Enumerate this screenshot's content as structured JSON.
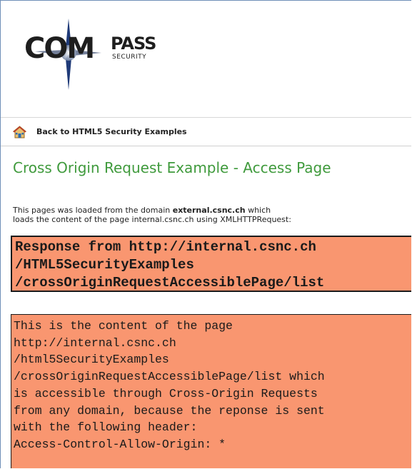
{
  "logo": {
    "word": "COM",
    "pass": "PASS",
    "security": "SECURITY",
    "icon": "compass-logo-icon"
  },
  "nav": {
    "home_icon": "home-icon",
    "back_link": "Back to HTML5 Security Examples"
  },
  "page": {
    "title": "Cross Origin Request Example - Access Page",
    "intro_line1_prefix": "This pages was loaded from the domain ",
    "intro_line1_domain": "external.csnc.ch",
    "intro_line1_suffix": " which",
    "intro_line2": "loads the content of the page internal.csnc.ch using XMLHTTPRequest:"
  },
  "response_box": {
    "lines": [
      "Response from http://internal.csnc.ch",
      "/HTML5SecurityExamples",
      "/crossOriginRequestAccessiblePage/list"
    ]
  },
  "content_box": {
    "lines": [
      "This is the content of the page",
      "http://internal.csnc.ch",
      "/html5SecurityExamples",
      "/crossOriginRequestAccessiblePage/list which",
      "is accessible through Cross-Origin Requests",
      "from any domain, because the reponse is sent",
      "with the following header:",
      "Access-Control-Allow-Origin: *"
    ]
  },
  "colors": {
    "title_green": "#3f9a3c",
    "box_orange": "#f99670",
    "frame_blue": "#6f8fb8"
  }
}
